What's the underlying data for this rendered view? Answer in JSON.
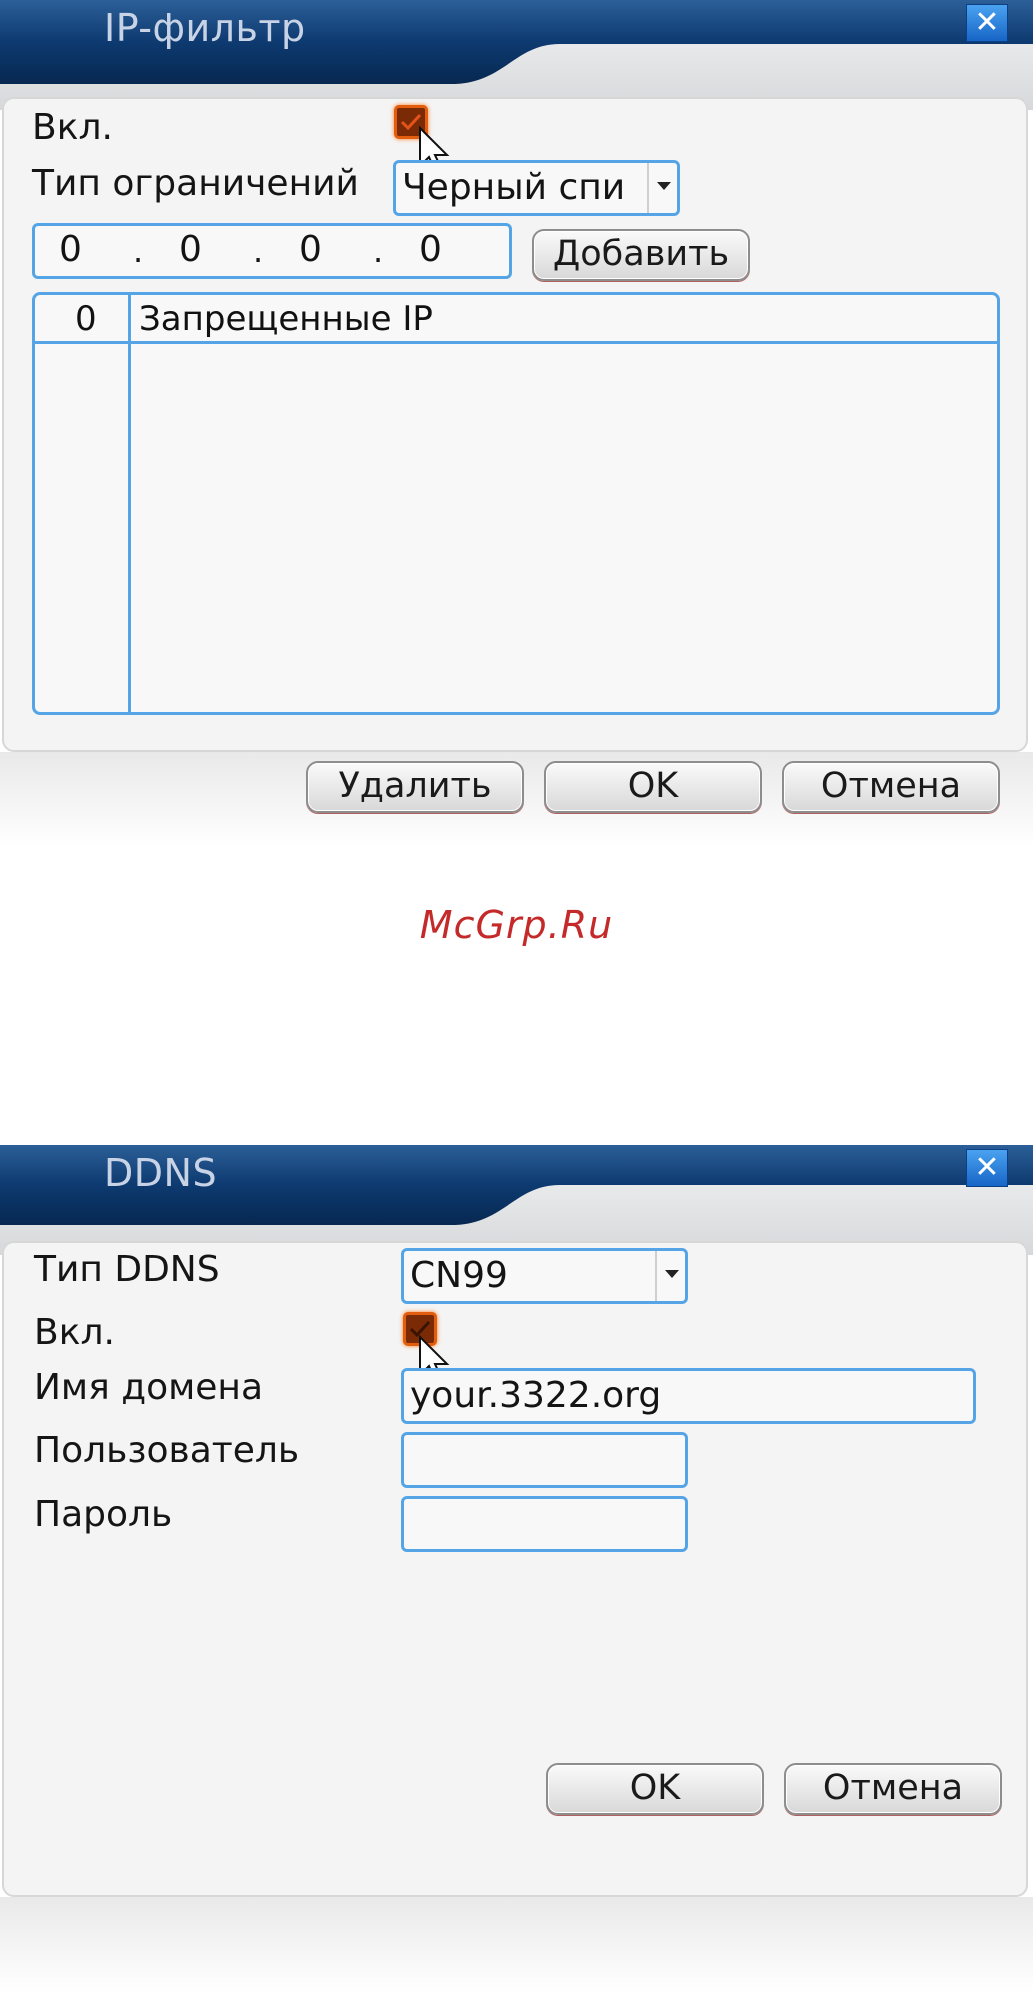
{
  "ip_filter": {
    "title": "IP-фильтр",
    "close_glyph": "✕",
    "enable_label": "Вкл.",
    "enable_checked": true,
    "restriction_type_label": "Тип ограничений",
    "restriction_type_value": "Черный спи",
    "ip_segments": [
      "0",
      "0",
      "0",
      "0"
    ],
    "ip_separator": ".",
    "add_label": "Добавить",
    "table": {
      "count": "0",
      "column_header": "Запрещенные IP",
      "rows": []
    },
    "delete_label": "Удалить",
    "ok_label": "OK",
    "cancel_label": "Отмена"
  },
  "watermark": "McGrp.Ru",
  "ddns": {
    "title": "DDNS",
    "close_glyph": "✕",
    "ddns_type_label": "Тип DDNS",
    "ddns_type_value": "CN99",
    "enable_label": "Вкл.",
    "enable_checked": true,
    "domain_label": "Имя домена",
    "domain_value": "your.3322.org",
    "user_label": "Пользователь",
    "user_value": "",
    "password_label": "Пароль",
    "password_value": "",
    "ok_label": "OK",
    "cancel_label": "Отмена"
  },
  "colors": {
    "title_bar": "#0e3a6e",
    "field_border": "#55a4e6",
    "checkbox_fill": "#7a2a05",
    "checkbox_border": "#e35d0f",
    "watermark": "#c52a2a"
  },
  "icons": [
    "close-icon",
    "checkmark-icon",
    "mouse-cursor-icon",
    "dropdown-arrow-icon"
  ]
}
